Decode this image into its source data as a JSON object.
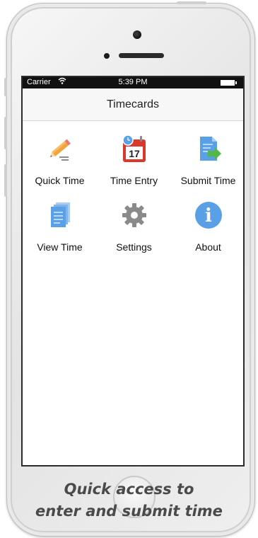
{
  "status_bar": {
    "carrier": "Carrier",
    "time": "5:39 PM",
    "wifi_icon": "wifi-icon",
    "battery_icon": "battery-icon"
  },
  "nav": {
    "title": "Timecards"
  },
  "menu": [
    {
      "label": "Quick Time",
      "icon": "pencil-icon"
    },
    {
      "label": "Time Entry",
      "icon": "calendar-icon",
      "icon_text": "17"
    },
    {
      "label": "Submit Time",
      "icon": "submit-document-icon"
    },
    {
      "label": "View Time",
      "icon": "documents-stack-icon"
    },
    {
      "label": "Settings",
      "icon": "gear-icon"
    },
    {
      "label": "About",
      "icon": "info-icon",
      "icon_text": "i"
    }
  ],
  "caption": {
    "line1": "Quick access to",
    "line2": "enter and submit time"
  },
  "colors": {
    "accent_blue": "#5aa0e6",
    "calendar_red": "#d9382b",
    "arrow_green": "#53b848",
    "gear_gray": "#8a8a8a",
    "pencil_orange": "#f2a33c"
  }
}
